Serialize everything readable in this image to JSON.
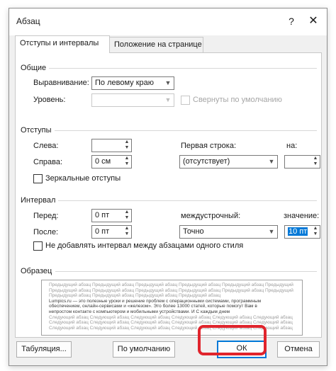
{
  "window": {
    "title": "Абзац",
    "help": "?",
    "close": "✕"
  },
  "tabs": [
    {
      "label": "Отступы и интервалы",
      "active": true
    },
    {
      "label": "Положение на странице",
      "active": false
    }
  ],
  "general": {
    "group_title": "Общие",
    "alignment_label": "Выравнивание:",
    "alignment_value": "По левому краю",
    "level_label": "Уровень:",
    "level_value": "",
    "collapsed_label": "Свернуты по умолчанию"
  },
  "indents": {
    "group_title": "Отступы",
    "left_label": "Слева:",
    "left_value": "",
    "right_label": "Справа:",
    "right_value": "0 см",
    "first_line_label": "Первая строка:",
    "first_line_value": "(отсутствует)",
    "on_label": "на:",
    "on_value": "",
    "mirror_label": "Зеркальные отступы"
  },
  "spacing": {
    "group_title": "Интервал",
    "before_label": "Перед:",
    "before_value": "0 пт",
    "after_label": "После:",
    "after_value": "0 пт",
    "line_spacing_label": "междустрочный:",
    "line_spacing_value": "Точно",
    "value_label": "значение:",
    "value_value": "10 пт",
    "no_space_label": "Не добавлять интервал между абзацами одного стиля"
  },
  "preview": {
    "group_title": "Образец",
    "prev_lines": [
      "Предыдущий абзац Предыдущий абзац Предыдущий абзац Предыдущий абзац Предыдущий абзац Предыдущий абзац",
      "Предыдущий абзац Предыдущий абзац Предыдущий абзац Предыдущий абзац Предыдущий абзац Предыдущий абзац",
      "Предыдущий абзац Предыдущий абзац Предыдущий абзац Предыдущий абзац"
    ],
    "sample_lines": [
      "Lumpics.ru — это полезные уроки и решение проблем с операционными системами, программным",
      "обеспечением, онлайн-сервисами и «железом». Это более 13000 статей, которые помогут Вам в",
      "непростом контакте с компьютером и мобильными устройствами. И С каждым днем"
    ],
    "next_lines": [
      "Следующий абзац Следующий абзац Следующий абзац Следующий абзац Следующий абзац Следующий абзац",
      "Следующий абзац Следующий абзац Следующий абзац Следующий абзац Следующий абзац Следующий абзац",
      "Следующий абзац Следующий абзац Следующий абзац Следующий абзац Следующий абзац Следующий абзац"
    ]
  },
  "buttons": {
    "tabs": "Табуляция...",
    "default": "По умолчанию",
    "ok": "ОК",
    "cancel": "Отмена"
  },
  "colors": {
    "highlight": "#e0242c",
    "accent": "#0078d7"
  }
}
